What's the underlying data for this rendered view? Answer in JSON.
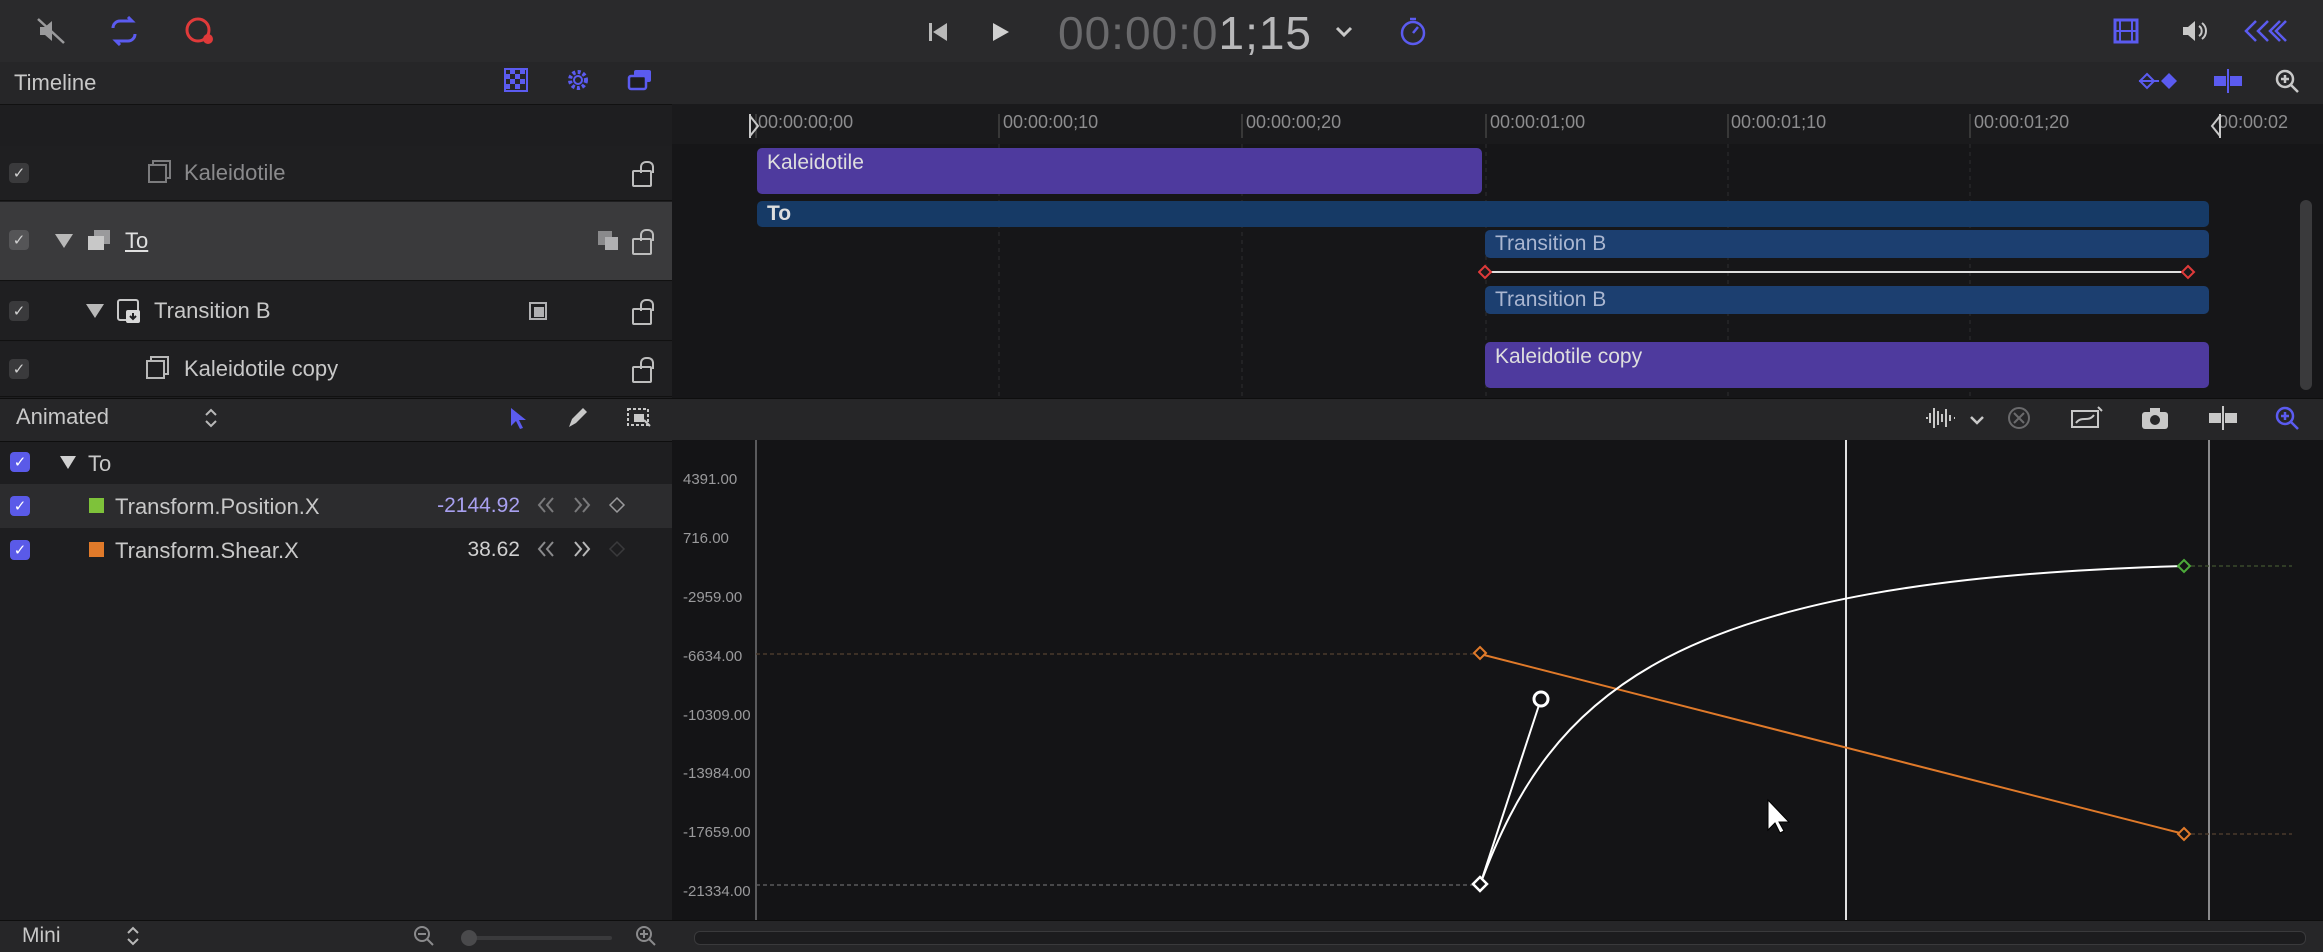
{
  "toolbar": {
    "mute_icon": "speaker-muted-icon",
    "loop_icon": "loop-icon",
    "record_icon": "record-icon",
    "go_start_icon": "go-to-start-icon",
    "play_icon": "play-icon",
    "timecode_dim": "00:00:0",
    "timecode_bright": "1;15",
    "timecode_menu_icon": "chevron-down-icon",
    "timer_icon": "stopwatch-icon",
    "filmstrip_icon": "filmstrip-icon",
    "volume_icon": "speaker-icon",
    "nav_icon": "double-chevron-icon"
  },
  "timeline": {
    "title": "Timeline",
    "ruler_labels": [
      "00:00:00;00",
      "00:00:00;10",
      "00:00:00;20",
      "00:00:01;00",
      "00:00:01;10",
      "00:00:01;20",
      "00:00:02"
    ],
    "layers": [
      {
        "name": "Kaleidotile",
        "checked": true
      },
      {
        "name": "To",
        "checked": true
      },
      {
        "name": "Transition B",
        "checked": true
      },
      {
        "name": "Kaleidotile copy",
        "checked": true
      }
    ],
    "clips": {
      "kaleidotile": "Kaleidotile",
      "to": "To",
      "transition_b_1": "Transition B",
      "transition_b_2": "Transition B",
      "kaleidotile_copy": "Kaleidotile copy"
    }
  },
  "animation": {
    "filter_label": "Animated",
    "group": "To",
    "params": [
      {
        "name": "Transform.Position.X",
        "value": "-2144.92",
        "color": "#7ec23a"
      },
      {
        "name": "Transform.Shear.X",
        "value": "38.62",
        "color": "#e07a2a"
      }
    ],
    "y_labels": [
      "4391.00",
      "716.00",
      "-2959.00",
      "-6634.00",
      "-10309.00",
      "-13984.00",
      "-17659.00",
      "-21334.00"
    ],
    "zoom_label": "Mini"
  },
  "colors": {
    "accent": "#5b5bf0",
    "clip_purple": "#4e3a9e",
    "clip_blue": "#163a66",
    "record_red": "#e03a3a",
    "curve_orange": "#e07a2a",
    "curve_white": "#ffffff"
  }
}
